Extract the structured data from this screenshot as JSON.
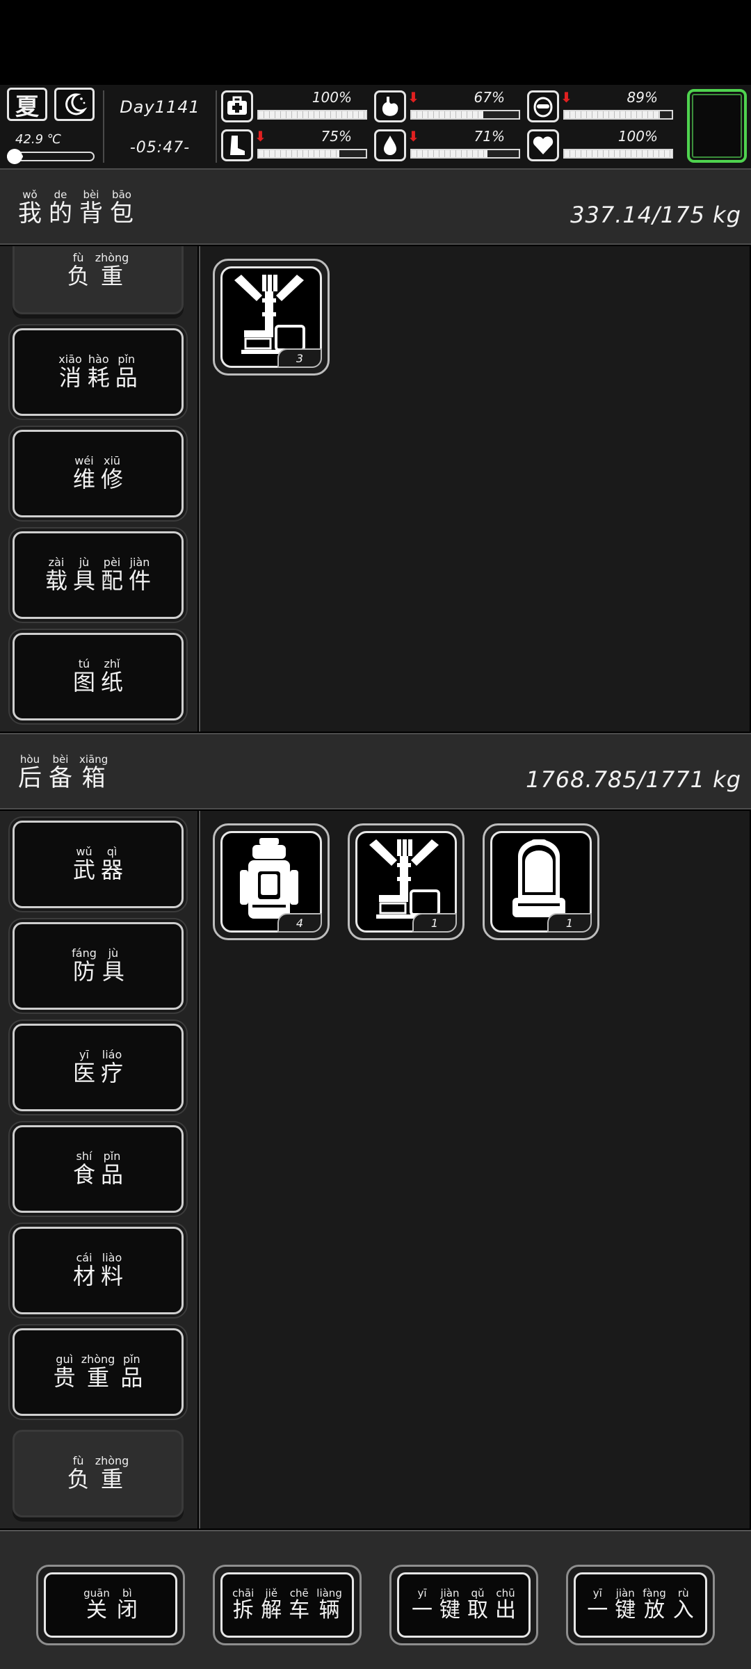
{
  "status": {
    "season": "夏",
    "temperature": "42.9 ℃",
    "temperature_level": 0.12,
    "day": "Day1141",
    "time": "-05:47-",
    "stats": [
      {
        "key": "health",
        "icon": "medkit-icon",
        "value": "100%",
        "level": 1.0,
        "falling": false
      },
      {
        "key": "hunger",
        "icon": "stomach-icon",
        "value": "67%",
        "level": 0.67,
        "falling": true
      },
      {
        "key": "mood",
        "icon": "brain-icon",
        "value": "89%",
        "level": 0.89,
        "falling": true
      },
      {
        "key": "stamina",
        "icon": "boot-icon",
        "value": "75%",
        "level": 0.75,
        "falling": true
      },
      {
        "key": "thirst",
        "icon": "water-drop-icon",
        "value": "71%",
        "level": 0.71,
        "falling": true
      },
      {
        "key": "heart",
        "icon": "heart-icon",
        "value": "100%",
        "level": 1.0,
        "falling": false
      }
    ]
  },
  "backpack": {
    "title_chars": [
      {
        "py": "wǒ",
        "zh": "我"
      },
      {
        "py": "de",
        "zh": "的"
      },
      {
        "py": "bèi",
        "zh": "背"
      },
      {
        "py": "bāo",
        "zh": "包"
      }
    ],
    "weight": "337.14/175 kg",
    "categories": [
      {
        "chars": [
          {
            "py": "fù",
            "zh": "负"
          },
          {
            "py": "zhòng",
            "zh": "重"
          }
        ],
        "active": true
      },
      {
        "chars": [
          {
            "py": "xiāo",
            "zh": "消"
          },
          {
            "py": "hào",
            "zh": "耗"
          },
          {
            "py": "pǐn",
            "zh": "品"
          }
        ]
      },
      {
        "chars": [
          {
            "py": "wéi",
            "zh": "维"
          },
          {
            "py": "xiū",
            "zh": "修"
          }
        ]
      },
      {
        "chars": [
          {
            "py": "zài",
            "zh": "载"
          },
          {
            "py": "jù",
            "zh": "具"
          },
          {
            "py": "pèi",
            "zh": "配"
          },
          {
            "py": "jiàn",
            "zh": "件"
          }
        ]
      },
      {
        "chars": [
          {
            "py": "tú",
            "zh": "图"
          },
          {
            "py": "zhǐ",
            "zh": "纸"
          }
        ]
      }
    ],
    "items": [
      {
        "icon": "cargo-rack-icon",
        "count": "3"
      }
    ]
  },
  "trunk": {
    "title_chars": [
      {
        "py": "hòu",
        "zh": "后"
      },
      {
        "py": "bèi",
        "zh": "备"
      },
      {
        "py": "xiāng",
        "zh": "箱"
      }
    ],
    "weight": "1768.785/1771 kg",
    "categories": [
      {
        "chars": [
          {
            "py": "wǔ",
            "zh": "武"
          },
          {
            "py": "qì",
            "zh": "器"
          }
        ]
      },
      {
        "chars": [
          {
            "py": "fáng",
            "zh": "防"
          },
          {
            "py": "jù",
            "zh": "具"
          }
        ]
      },
      {
        "chars": [
          {
            "py": "yī",
            "zh": "医"
          },
          {
            "py": "liáo",
            "zh": "疗"
          }
        ]
      },
      {
        "chars": [
          {
            "py": "shí",
            "zh": "食"
          },
          {
            "py": "pǐn",
            "zh": "品"
          }
        ]
      },
      {
        "chars": [
          {
            "py": "cái",
            "zh": "材"
          },
          {
            "py": "liào",
            "zh": "料"
          }
        ]
      },
      {
        "chars": [
          {
            "py": "guì",
            "zh": "贵"
          },
          {
            "py": "zhòng",
            "zh": "重"
          },
          {
            "py": "pǐn",
            "zh": "品"
          }
        ]
      },
      {
        "chars": [
          {
            "py": "fù",
            "zh": "负"
          },
          {
            "py": "zhòng",
            "zh": "重"
          }
        ],
        "active": true
      }
    ],
    "items": [
      {
        "icon": "hiking-backpack-icon",
        "count": "4"
      },
      {
        "icon": "cargo-rack-icon",
        "count": "1"
      },
      {
        "icon": "school-backpack-icon",
        "count": "1"
      }
    ]
  },
  "bottom_buttons": [
    {
      "name": "close-button",
      "chars": [
        {
          "py": "guān",
          "zh": "关"
        },
        {
          "py": "bì",
          "zh": "闭"
        }
      ]
    },
    {
      "name": "dismantle-vehicle-button",
      "chars": [
        {
          "py": "chāi",
          "zh": "拆"
        },
        {
          "py": "jiě",
          "zh": "解"
        },
        {
          "py": "chē",
          "zh": "车"
        },
        {
          "py": "liàng",
          "zh": "辆"
        }
      ]
    },
    {
      "name": "take-all-button",
      "chars": [
        {
          "py": "yī",
          "zh": "一"
        },
        {
          "py": "jiàn",
          "zh": "键"
        },
        {
          "py": "qǔ",
          "zh": "取"
        },
        {
          "py": "chū",
          "zh": "出"
        }
      ]
    },
    {
      "name": "put-all-button",
      "chars": [
        {
          "py": "yī",
          "zh": "一"
        },
        {
          "py": "jiàn",
          "zh": "键"
        },
        {
          "py": "fàng",
          "zh": "放"
        },
        {
          "py": "rù",
          "zh": "入"
        }
      ]
    }
  ]
}
